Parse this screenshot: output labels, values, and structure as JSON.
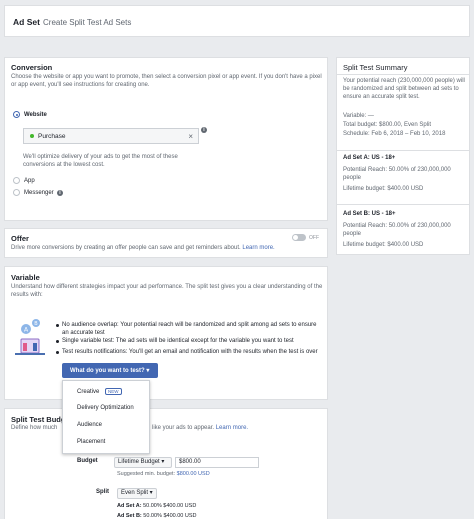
{
  "header": {
    "title": "Ad Set",
    "subtitle": "Create Split Test Ad Sets"
  },
  "conversion": {
    "title": "Conversion",
    "desc": "Choose the website or app you want to promote, then select a conversion pixel or app event. If you don't have a pixel or app event, you'll see instructions for creating one.",
    "website_label": "Website",
    "event_value": "Purchase",
    "optimize_note": "We'll optimize delivery of your ads to get the most of these conversions at the lowest cost.",
    "app_label": "App",
    "messenger_label": "Messenger"
  },
  "offer": {
    "title": "Offer",
    "desc": "Drive more conversions by creating an offer people can save and get reminders about.",
    "learn_more": "Learn more.",
    "toggle_label": "OFF"
  },
  "variable": {
    "title": "Variable",
    "desc": "Understand how different strategies impact your ad performance. The split test gives you a clear understanding of the results with:",
    "bullets": [
      "No audience overlap: Your potential reach will be randomized and split among ad sets to ensure an accurate test",
      "Single variable test: The ad sets will be identical except for the variable you want to test",
      "Test results notifications: You'll get an email and notification with the results when the test is over"
    ],
    "dropdown_label": "What do you want to test? ▾",
    "options": [
      "Creative",
      "Delivery Optimization",
      "Audience",
      "Placement"
    ],
    "new_badge": "NEW"
  },
  "budget": {
    "title": "Split Test Budg",
    "desc_left": "Define how much",
    "desc_right": "like your ads to appear.",
    "learn_more": "Learn more.",
    "budget_label": "Budget",
    "budget_type": "Lifetime Budget ▾",
    "budget_value": "$800.00",
    "suggested_prefix": "Suggested min. budget:",
    "suggested_value": "$800.00 USD",
    "split_label": "Split",
    "split_value": "Even Split ▾",
    "ad_a": "Ad Set A:",
    "ad_a_pct": "50.00%",
    "ad_a_amt": "$400.00 USD",
    "ad_b": "Ad Set B:",
    "ad_b_pct": "50.00%",
    "ad_b_amt": "$400.00 USD"
  },
  "summary": {
    "title": "Split Test Summary",
    "intro": "Your potential reach (230,000,000 people) will be randomized and split between ad sets to ensure an accurate split test.",
    "variable_label": "Variable:",
    "variable_value": "—",
    "total_budget": "Total budget: $800.00, Even Split",
    "schedule": "Schedule: Feb 6, 2018 – Feb 10, 2018",
    "adset_a_title": "Ad Set A: US - 18+",
    "adset_a_reach": "Potential Reach: 50.00% of 230,000,000 people",
    "adset_a_budget": "Lifetime budget: $400.00 USD",
    "adset_b_title": "Ad Set B: US - 18+",
    "adset_b_reach": "Potential Reach: 50.00% of 230,000,000 people",
    "adset_b_budget": "Lifetime budget: $400.00 USD"
  },
  "colors": {
    "accent": "#4267b2",
    "success": "#42b72a"
  }
}
